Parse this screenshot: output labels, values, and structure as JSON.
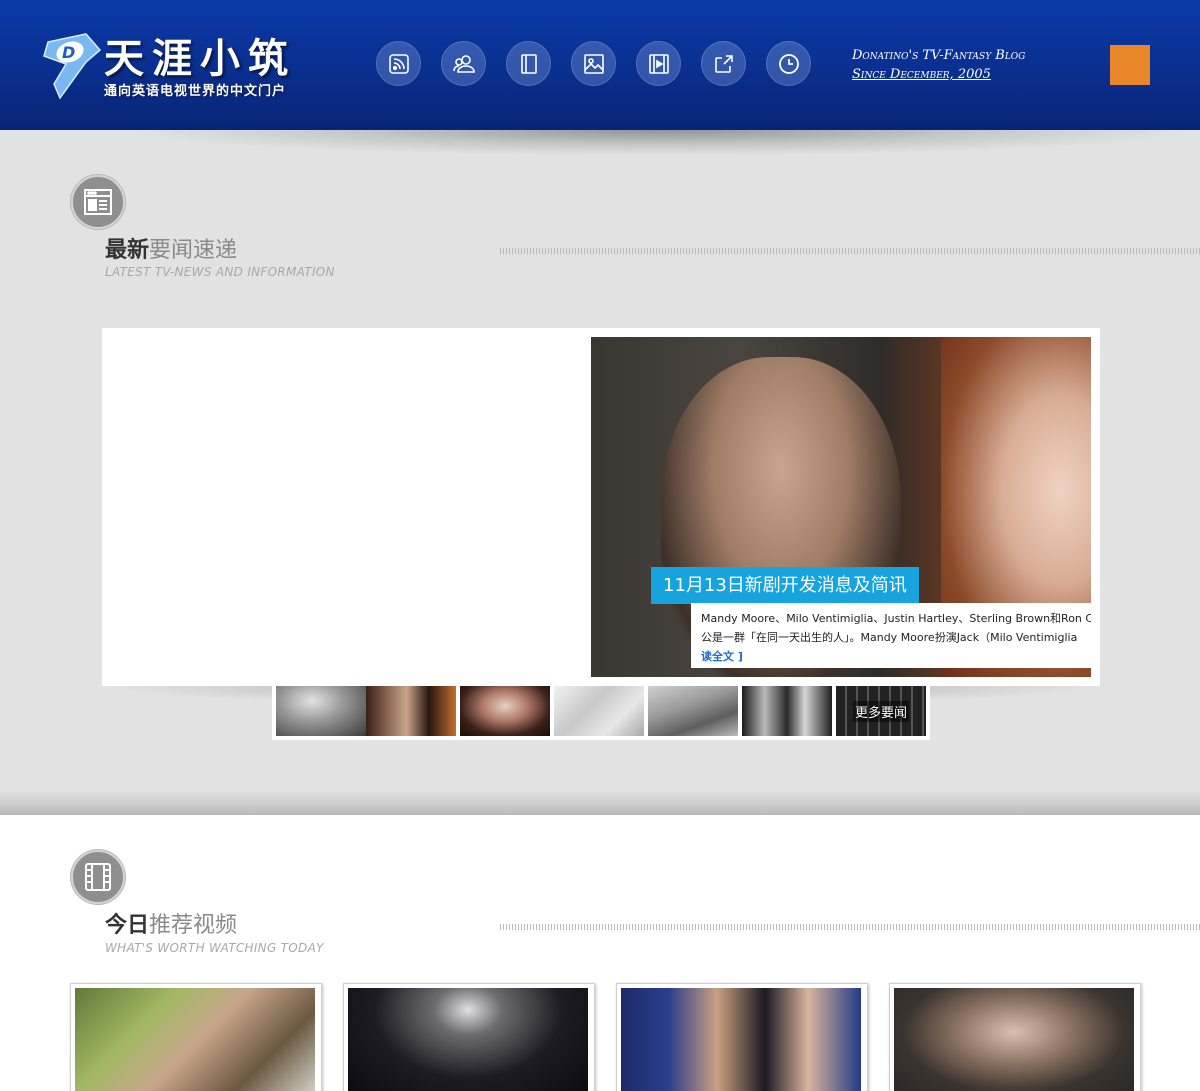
{
  "header": {
    "logo_title": "天涯小筑",
    "logo_subtitle": "通向英语电视世界的中文门户",
    "tagline_line1": "Donatino's TV-Fantasy Blog",
    "tagline_line2": "Since December, 2005",
    "nav_icons": [
      "rss-icon",
      "users-icon",
      "book-icon",
      "image-icon",
      "film-icon",
      "share-icon",
      "clock-icon"
    ],
    "accent_orange": "#e8862a"
  },
  "news_section": {
    "title_bold": "最新",
    "title_light": "要闻速递",
    "subtitle": "LATEST TV-NEWS AND INFORMATION"
  },
  "slider": {
    "caption_title": "11月13日新剧开发消息及简讯",
    "caption_line1": "Mandy Moore、Milo Ventimiglia、Justin Hartley、Sterling Brown和Ron Cephas Jones",
    "caption_line2": "公是一群「在同一天出生的人」。Mandy Moore扮演Jack（Milo Ventimiglia",
    "read_more": "读全文 ]"
  },
  "thumbnails": {
    "more_label": "更多要闻"
  },
  "video_section": {
    "title_bold": "今日",
    "title_light": "推荐视频",
    "subtitle": "WHAT'S WORTH WATCHING TODAY"
  },
  "colors": {
    "header_blue": "#0a2f8f",
    "caption_blue": "#17a3dd",
    "link_blue": "#1e6fc8"
  }
}
